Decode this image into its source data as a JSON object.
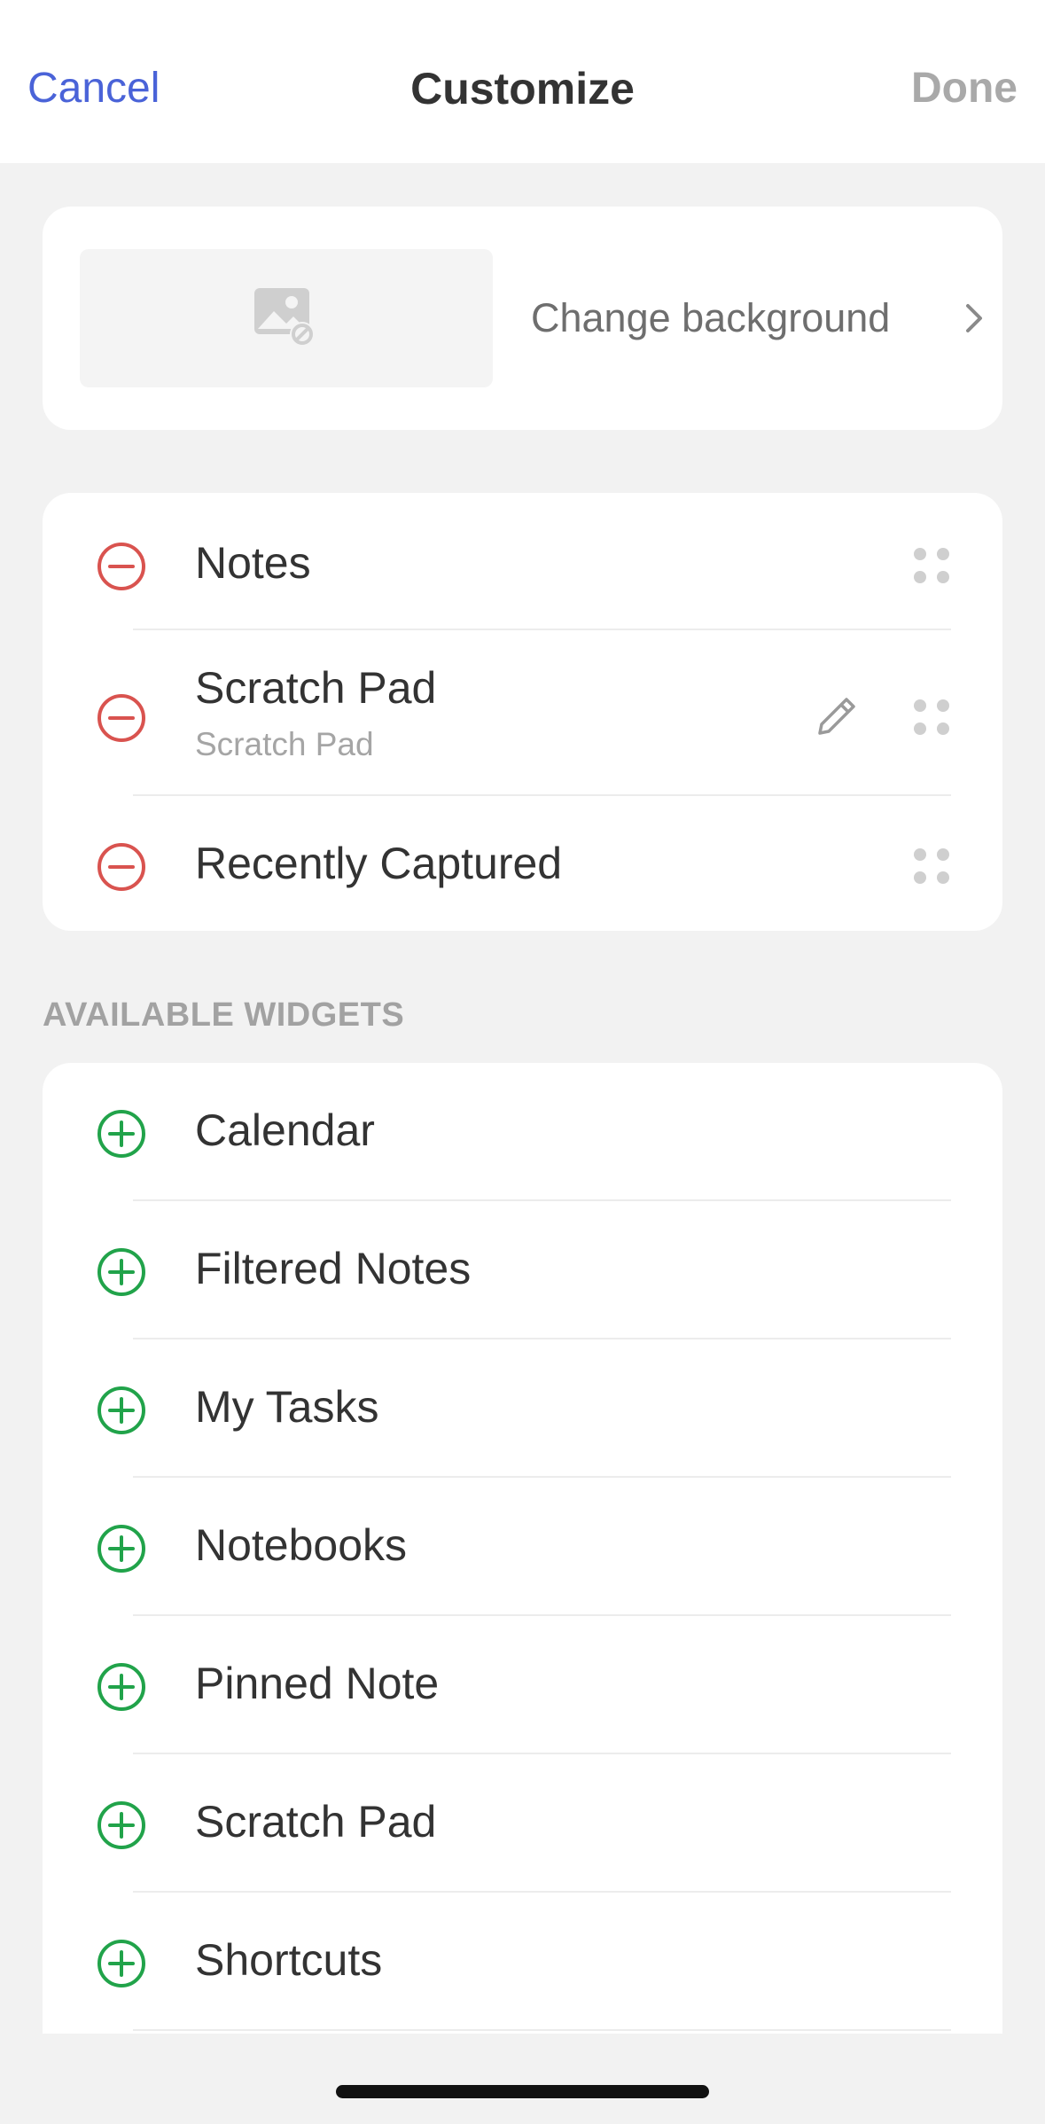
{
  "header": {
    "cancel_label": "Cancel",
    "title": "Customize",
    "done_label": "Done"
  },
  "background": {
    "change_label": "Change background"
  },
  "active_widgets": [
    {
      "label": "Notes",
      "sublabel": "",
      "editable": false
    },
    {
      "label": "Scratch Pad",
      "sublabel": "Scratch Pad",
      "editable": true
    },
    {
      "label": "Recently Captured",
      "sublabel": "",
      "editable": false
    }
  ],
  "available_section_title": "AVAILABLE WIDGETS",
  "available_widgets": [
    {
      "label": "Calendar"
    },
    {
      "label": "Filtered Notes"
    },
    {
      "label": "My Tasks"
    },
    {
      "label": "Notebooks"
    },
    {
      "label": "Pinned Note"
    },
    {
      "label": "Scratch Pad"
    },
    {
      "label": "Shortcuts"
    }
  ],
  "colors": {
    "accent": "#4a63d8",
    "remove": "#d9534f",
    "add": "#21a34a",
    "disabled": "#a9a9a9"
  },
  "icons": {
    "remove": "minus-circle-icon",
    "add": "plus-circle-icon",
    "drag": "drag-handle-icon",
    "edit": "pencil-icon",
    "no_image": "image-off-icon",
    "chevron": "chevron-right-icon"
  }
}
